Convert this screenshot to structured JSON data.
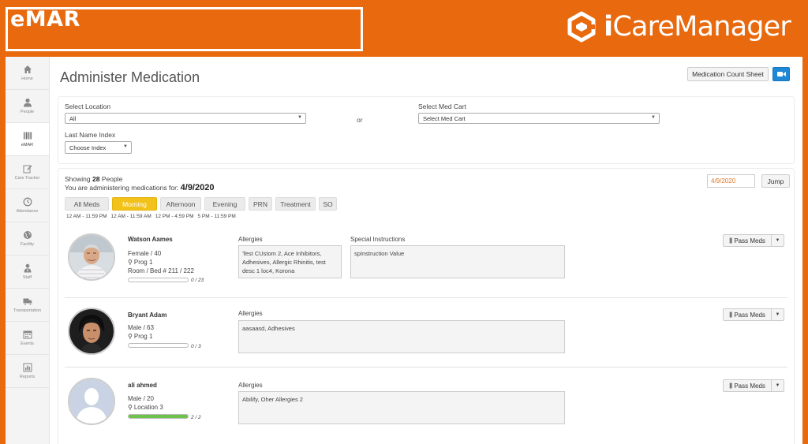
{
  "banner": {
    "title": "eMAR",
    "brand_prefix": "i",
    "brand_rest": "CareManager"
  },
  "sidebar": {
    "items": [
      {
        "label": "Home",
        "icon": "home-icon"
      },
      {
        "label": "People",
        "icon": "person-icon"
      },
      {
        "label": "eMAR",
        "icon": "barcode-icon",
        "active": true
      },
      {
        "label": "Care Tracker",
        "icon": "edit-icon"
      },
      {
        "label": "Attendance",
        "icon": "clock-icon"
      },
      {
        "label": "Facility",
        "icon": "globe-icon"
      },
      {
        "label": "Staff",
        "icon": "staff-icon"
      },
      {
        "label": "Transportation",
        "icon": "truck-icon"
      },
      {
        "label": "Events",
        "icon": "calendar-icon"
      },
      {
        "label": "Reports",
        "icon": "chart-icon"
      }
    ]
  },
  "header": {
    "title": "Administer Medication",
    "count_sheet_label": "Medication Count Sheet",
    "video_icon": "video-camera-icon"
  },
  "filters": {
    "location_label": "Select Location",
    "location_value": "All",
    "or_text": "or",
    "med_cart_label": "Select Med Cart",
    "med_cart_value": "Select Med Cart",
    "name_index_label": "Last Name Index",
    "name_index_value": "Choose Index"
  },
  "summary": {
    "showing_prefix": "Showing",
    "count": "28",
    "showing_suffix": "People",
    "administering_text": "You are administering medications for:",
    "date": "4/9/2020",
    "date_input": "4/9/2020",
    "jump_label": "Jump"
  },
  "tabs": [
    {
      "label": "All Meds",
      "active": false
    },
    {
      "label": "Morning",
      "active": true
    },
    {
      "label": "Afternoon",
      "active": false
    },
    {
      "label": "Evening",
      "active": false
    },
    {
      "label": "PRN",
      "active": false
    },
    {
      "label": "Treatment",
      "active": false
    },
    {
      "label": "SO",
      "active": false
    }
  ],
  "times": [
    "12 AM - 11:59 PM",
    "12 AM - 11:59 AM",
    "12 PM - 4:59 PM",
    "5 PM - 11:59 PM"
  ],
  "people": [
    {
      "name": "Watson Aames",
      "gender_age": "Female / 40",
      "program": "Prog 1",
      "room": "Room / Bed # 211 / 222",
      "progress_text": "0 / 23",
      "progress": 0,
      "allergies_label": "Allergies",
      "allergies": "Test CUstom 2, Ace Inhibitors, Adhesives, Allergic Rhinitis, test desc 1 loc4, Korona",
      "special_label": "Special Instructions",
      "special": "spInstruction Value",
      "pass_label": "Pass Meds"
    },
    {
      "name": "Bryant Adam",
      "gender_age": "Male / 63",
      "program": "Prog 1",
      "progress_text": "0 / 3",
      "progress": 0,
      "allergies_label": "Allergies",
      "allergies": "aasaasd, Adhesives",
      "pass_label": "Pass Meds"
    },
    {
      "name": "ali ahmed",
      "gender_age": "Male / 20",
      "program": "Location 3",
      "progress_text": "2 / 2",
      "progress": 1,
      "allergies_label": "Allergies",
      "allergies": "Abilify, Oher Allergies 2",
      "pass_label": "Pass Meds"
    }
  ],
  "colors": {
    "brand_orange": "#e8690e",
    "active_tab": "#f3c21a",
    "video_button": "#1e88d6",
    "progress_complete": "#6cc24a"
  }
}
